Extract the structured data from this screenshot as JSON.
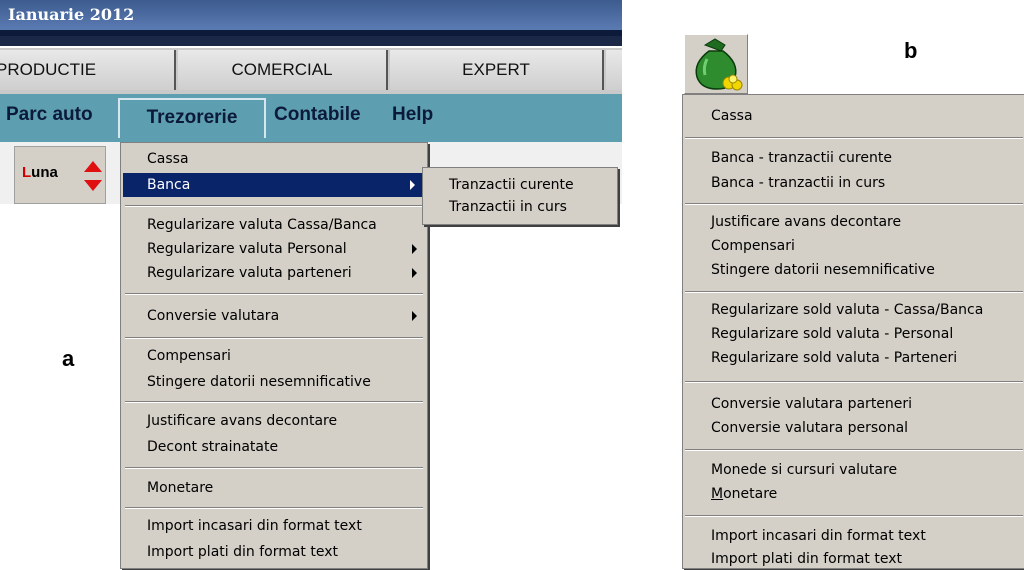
{
  "panel_a": {
    "title": "Ianuarie 2012",
    "modules": [
      "PRODUCTIE",
      "COMERCIAL",
      "EXPERT"
    ],
    "menubar": [
      "Parc auto",
      "Trezorerie",
      "Contabile",
      "Help"
    ],
    "toolbar": {
      "luna_first": "L",
      "luna_rest": "una"
    },
    "menu": {
      "cassa": "Cassa",
      "banca": "Banca",
      "reg_cassa_banca": "Regularizare valuta Cassa/Banca",
      "reg_personal": "Regularizare valuta Personal",
      "reg_parteneri": "Regularizare valuta parteneri",
      "conversie": "Conversie valutara",
      "compensari": "Compensari",
      "stingere": "Stingere datorii nesemnificative",
      "justificare": "Justificare avans decontare",
      "decont": "Decont strainatate",
      "monetare": "Monetare",
      "import_incasari": "Import incasari din format text",
      "import_plati": "Import plati din format text"
    },
    "submenu": {
      "curente": "Tranzactii curente",
      "in_curs": "Tranzactii in curs"
    },
    "label": "a"
  },
  "panel_b": {
    "label": "b",
    "icon": "money-bag-icon",
    "menu": {
      "cassa": "Cassa",
      "banca_curente": "Banca - tranzactii curente",
      "banca_in_curs": "Banca - tranzactii in curs",
      "justificare": "Justificare avans decontare",
      "compensari": "Compensari",
      "stingere": "Stingere datorii nesemnificative",
      "reg_cassa_banca": "Regularizare sold valuta - Cassa/Banca",
      "reg_personal": "Regularizare sold valuta - Personal",
      "reg_parteneri": "Regularizare sold valuta - Parteneri",
      "conv_parteneri": "Conversie valutara parteneri",
      "conv_personal": "Conversie valutara personal",
      "monede": "Monede si cursuri valutare",
      "monetare_first": "M",
      "monetare_rest": "onetare",
      "import_incasari": "Import incasari din format text",
      "import_plati": "Import plati din format text"
    }
  },
  "colors": {
    "title_bar": "#4a6aa0",
    "menu_bar": "#5d9eb0",
    "menu_bg": "#d4d0c8",
    "selection": "#0a246a",
    "accent_red": "#e01010"
  }
}
